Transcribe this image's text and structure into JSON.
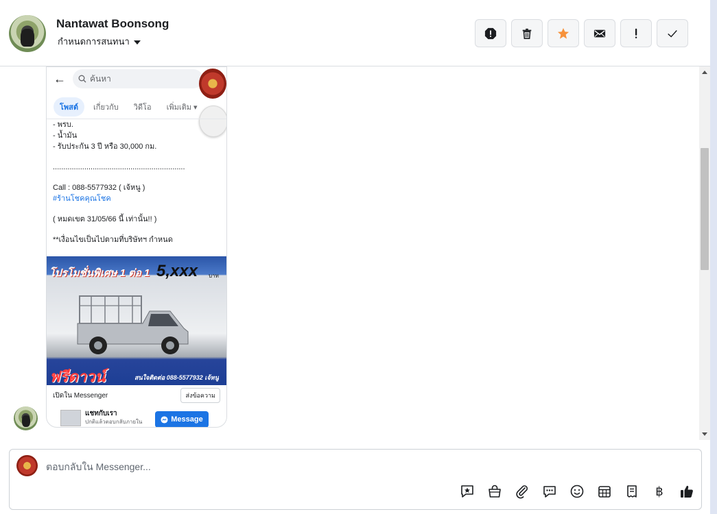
{
  "header": {
    "name": "Nantawat Boonsong",
    "subtitle": "กำหนดการสนทนา",
    "toolbar_icons": [
      "report-icon",
      "trash-icon",
      "star-icon",
      "envelope-icon",
      "exclamation-icon",
      "check-icon"
    ],
    "star_color": "#f7923b"
  },
  "phone": {
    "search_placeholder": "ค้นหา",
    "tabs": [
      "โพสต์",
      "เกี่ยวกับ",
      "วิดีโอ",
      "เพิ่มเติม"
    ],
    "lines": [
      "- พรบ.",
      "- น้ำมัน",
      "- รับประกัน 3 ปี หรือ 30,000 กม.",
      "",
      "...............................................................",
      "",
      "Call : 088-5577932 ( เจ้หนู )",
      "#ร้านโชคคุณโชค",
      "",
      "( หมดเขต 31/05/66 นี้ เท่านั้น!! )",
      "",
      "**เงื่อนไขเป็นไปตามที่บริษัทฯ กำหนด"
    ],
    "banner": {
      "promo": "โปรโมชั่นพิเศษ 1 ต่อ 1",
      "price": "5,xxx",
      "baht": "บาท",
      "down": "ฟรีดาวน์",
      "contact": "สนใจติดต่อ 088-5577932 เจ้หนู"
    },
    "open_in_messenger": "เปิดใน Messenger",
    "send_message": "ส่งข้อความ",
    "chat_title": "แชทกับเรา",
    "chat_sub": "ปกติแล้วตอบกลับภายใน",
    "message_button": "Message"
  },
  "composer": {
    "placeholder": "ตอบกลับใน Messenger...",
    "tools": [
      "saved-reply-icon",
      "shop-bag-icon",
      "attachment-icon",
      "chat-bubbles-icon",
      "emoji-icon",
      "appointment-icon",
      "invoice-icon",
      "baht-icon",
      "thumbs-up-icon"
    ],
    "baht_symbol": "฿"
  },
  "colors": {
    "accent_blue": "#1b74e4",
    "border": "#dadde1"
  }
}
